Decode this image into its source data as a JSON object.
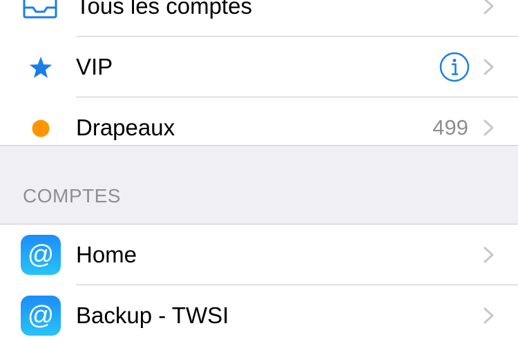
{
  "mailboxes": [
    {
      "label": "Tous les comptes",
      "icon": "inbox-icon"
    },
    {
      "label": "VIP",
      "icon": "star-icon",
      "accessory": "info-icon",
      "accent": "#1a7ee8"
    },
    {
      "label": "Drapeaux",
      "icon": "flag-dot-icon",
      "count": "499",
      "accent": "#ff9500"
    }
  ],
  "accounts_section": {
    "header": "COMPTES",
    "items": [
      {
        "label": "Home",
        "icon": "mail-account-icon",
        "glyph": "@"
      },
      {
        "label": "Backup - TWSI",
        "icon": "mail-account-icon",
        "glyph": "@"
      }
    ]
  },
  "colors": {
    "accent_blue": "#1a7ee8",
    "flag_orange": "#ff9500",
    "separator": "#c8c7cc",
    "background": "#efeff4",
    "chevron": "#c7c7cc",
    "secondary_text": "#8e8e93"
  }
}
